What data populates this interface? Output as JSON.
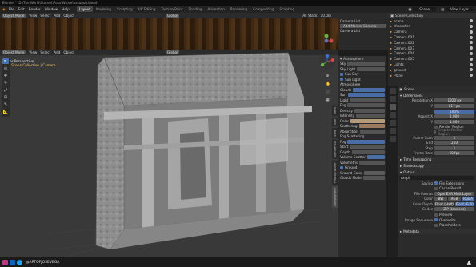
{
  "app": {
    "title": "Blender* [D:\\The World\\Current\\Paku\\Whale\\pakuhub.blend]"
  },
  "menu": [
    "File",
    "Edit",
    "Render",
    "Window",
    "Help"
  ],
  "workspaces": [
    {
      "label": "Layout",
      "active": true
    },
    {
      "label": "Modeling",
      "active": false
    },
    {
      "label": "Sculpting",
      "active": false
    },
    {
      "label": "UV Editing",
      "active": false
    },
    {
      "label": "Texture Paint",
      "active": false
    },
    {
      "label": "Shading",
      "active": false
    },
    {
      "label": "Animation",
      "active": false
    },
    {
      "label": "Rendering",
      "active": false
    },
    {
      "label": "Compositing",
      "active": false
    },
    {
      "label": "Scripting",
      "active": false
    }
  ],
  "topright": {
    "scene": "Scene",
    "view_layer": "View Layer"
  },
  "upper_viewport": {
    "mode": "Object Mode",
    "menu": [
      "View",
      "Select",
      "Add",
      "Object"
    ],
    "transform": "Global",
    "camera_list_title": "Camera List",
    "add_camera_btn": "Add Master Camera",
    "camera_list_label": "Camera List",
    "af_stack": "AF Stack",
    "focal": "10.0m"
  },
  "viewport": {
    "mode": "Object Mode",
    "menu": [
      "View",
      "Select",
      "Add",
      "Object"
    ],
    "transform": "Global",
    "overlay_line1": "User Perspective",
    "overlay_line2": "(0) Scene Collection | Camera",
    "af_stack": "AF Stack",
    "focal": "10.0m"
  },
  "atmosphere_panel": {
    "header": "Atmosphere",
    "rows": [
      "Sky",
      "Sky Light",
      "Sun Day",
      "Sun Light",
      "Atmosphere",
      "Clouds",
      "Sun",
      "Light",
      "Fog",
      "Density",
      "Intensity",
      "Color",
      "Scattering",
      "Absorption",
      "Fog Scattering",
      "Fog",
      "Start",
      "Depth",
      "Volume Scatter",
      "Volumetric",
      "Ground",
      "Ground Color",
      "Clouds Mode"
    ]
  },
  "vertical_tabs": [
    "Item",
    "Tool",
    "View",
    "BlenderKit",
    "Photographer",
    "Atmosphere",
    "Edit"
  ],
  "outliner": {
    "header": "Scene Collection",
    "items": [
      "scene",
      "character",
      "Camera",
      "Camera.001",
      "Camera.002",
      "Camera.003",
      "Camera.004",
      "Camera.005",
      "Lights",
      "ground",
      "Plane"
    ]
  },
  "properties": {
    "scene_label": "Scene",
    "dimensions_header": "Dimensions",
    "resolution_x_label": "Resolution X",
    "resolution_x": "1920 px",
    "resolution_y_label": "Y",
    "resolution_y": "817 px",
    "percent": "100%",
    "aspect_x_label": "Aspect X",
    "aspect_x": "1.000",
    "aspect_y_label": "Y",
    "aspect_y": "1.000",
    "render_region": "Render Region",
    "crop": "Crop to Render Region",
    "frame_start_label": "Frame Start",
    "frame_start": "1",
    "frame_end_label": "End",
    "frame_end": "250",
    "frame_step_label": "Step",
    "frame_step": "1",
    "frame_rate_label": "Frame Rate",
    "frame_rate": "60 fps",
    "time_remap": "Time Remapping",
    "stereoscopy": "Stereoscopy",
    "output_header": "Output",
    "output_path": "/tmp\\",
    "saving_label": "Saving",
    "file_ext": "File Extensions",
    "cache_result": "Cache Result",
    "file_format_label": "File Format",
    "file_format": "OpenEXR MultiLayer",
    "color_label": "Color",
    "color_bw": "BW",
    "color_rgb": "RGB",
    "color_rgba": "RGBA",
    "color_depth_label": "Color Depth",
    "depth_half": "Float (Half)",
    "depth_full": "Float (Full)",
    "codec_label": "Codec",
    "codec": "ZIP (lossless)",
    "preview": "Preview",
    "image_seq_label": "Image Sequence",
    "overwrite": "Overwrite",
    "placeholders": "Placeholders",
    "metadata": "Metadata"
  },
  "status": {
    "social": "@ARTOFJOSEVEGA"
  },
  "colors": {
    "accent": "#4772b3",
    "panel": "#2b2b2b",
    "header": "#232323"
  }
}
